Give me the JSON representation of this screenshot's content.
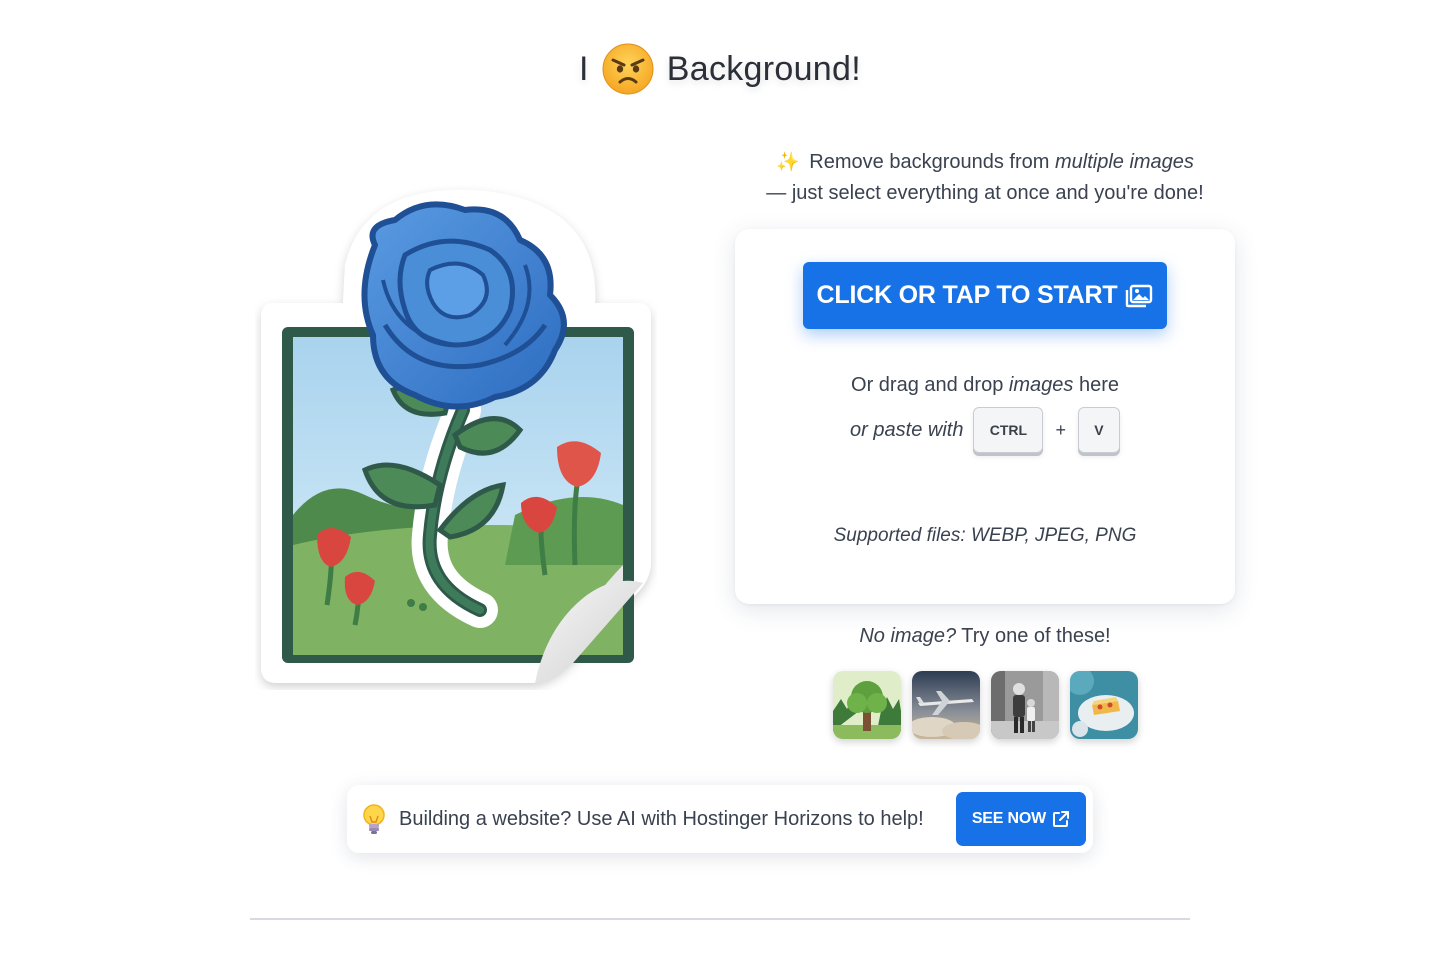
{
  "header": {
    "title_prefix": "I",
    "title_emoji": "angry-face-emoji",
    "title_suffix": "Background!"
  },
  "tagline": {
    "sparkle_icon": "sparkles-icon",
    "line1_prefix": "Remove backgrounds from",
    "line1_emphasis": "multiple images",
    "line2": "— just select everything at once and you're done!"
  },
  "upload": {
    "start_label": "CLICK OR TAP TO START",
    "start_icon": "images-icon",
    "drag_prefix": "Or drag and drop",
    "drag_emphasis": "images",
    "drag_suffix": "here",
    "paste_label": "or paste with",
    "key_ctrl": "CTRL",
    "key_plus": "+",
    "key_v": "V",
    "supported_label": "Supported files:",
    "supported_formats": "WEBP, JPEG, PNG"
  },
  "samples": {
    "prompt_emphasis": "No image?",
    "prompt_rest": "Try one of these!",
    "items": [
      {
        "name": "sample-tree-thumbnail"
      },
      {
        "name": "sample-airplane-thumbnail"
      },
      {
        "name": "sample-people-thumbnail"
      },
      {
        "name": "sample-food-thumbnail"
      }
    ]
  },
  "promo": {
    "icon": "lightbulb-icon",
    "text": "Building a website? Use AI with Hostinger Horizons to help!",
    "button_label": "SEE NOW",
    "button_icon": "external-link-icon"
  },
  "colors": {
    "accent": "#1672e6",
    "text": "#3a4250",
    "rose_blue": "#3b7fd1",
    "frame_green": "#2f5a4a"
  }
}
